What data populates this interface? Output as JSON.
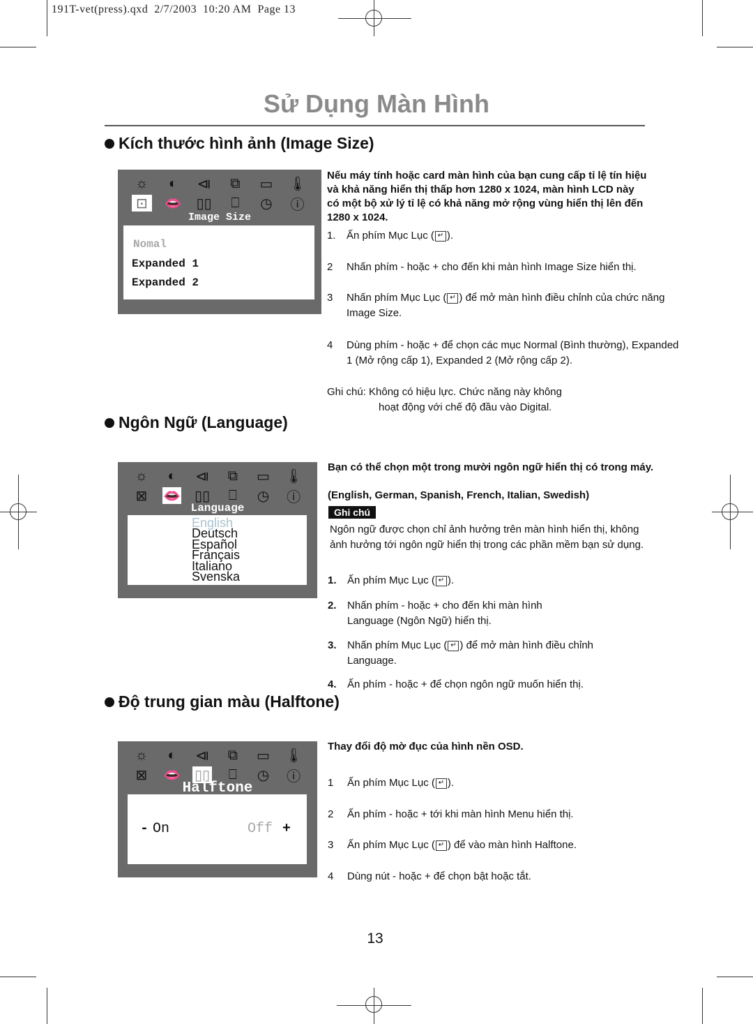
{
  "slug": "191T-vet(press).qxd  2/7/2003  10:20 AM  Page 13",
  "page_title": "Sử Dụng Màn Hình",
  "page_number": "13",
  "enter_key_glyph": "↵",
  "osd_icons": [
    "brightness-icon",
    "contrast-icon",
    "position-icon",
    "window-icon",
    "video-icon",
    "color-temperature-icon",
    "image-size-icon",
    "language-icon",
    "halftone-icon",
    "osd-position-icon",
    "timer-icon",
    "information-icon"
  ],
  "osd_icon_glyphs": [
    "☼",
    "◐",
    "◁",
    "⧉",
    "▭",
    "🌡",
    "⊠",
    "👄",
    "▯",
    "⎕",
    "◷",
    "ⓘ"
  ],
  "sections": {
    "image_size": {
      "heading": "Kích thước hình ảnh (Image Size)",
      "osd_title": "Image Size",
      "options": [
        {
          "label": "Nomal",
          "state": "inactive"
        },
        {
          "label": "Expanded 1",
          "state": "active"
        },
        {
          "label": "Expanded 2",
          "state": "active"
        }
      ],
      "intro": "Nếu máy tính hoặc card màn hình của bạn cung cấp tỉ lệ tín hiệu và khả năng hiển thị thấp hơn 1280 x 1024, màn hình LCD này có một bộ xử lý tỉ lệ có khả năng mở rộng vùng hiển thị lên đến 1280 x 1024.",
      "steps": [
        {
          "n": "1.",
          "pre": "Ấn phím Mục Lục (",
          "post": ")."
        },
        {
          "n": "2",
          "pre": "Nhấn phím - hoặc + cho đến khi màn hình Image Size hiển thị.",
          "post": ""
        },
        {
          "n": "3",
          "pre": "Nhấn phím Mục Lục (",
          "post": ") để mở màn hình điều chỉnh của chức năng Image Size."
        },
        {
          "n": "4",
          "pre": "Dùng phím - hoặc + để chọn các mục Normal (Bình thường), Expanded 1 (Mở rộng cấp 1), Expanded 2 (Mở rộng cấp 2).",
          "post": ""
        }
      ],
      "note_line1": "Ghi chú: Không có hiệu lực. Chức năng này không",
      "note_line2": "hoạt động với chế độ đầu vào Digital."
    },
    "language": {
      "heading": "Ngôn Ngữ (Language)",
      "osd_title": "Language",
      "options": [
        {
          "label": "English",
          "state": "selected"
        },
        {
          "label": "Deutsch",
          "state": "normal"
        },
        {
          "label": "Español",
          "state": "normal"
        },
        {
          "label": "Français",
          "state": "normal"
        },
        {
          "label": "Italiano",
          "state": "normal"
        },
        {
          "label": "Svenska",
          "state": "normal"
        }
      ],
      "intro": "Bạn có thể chọn một trong mười ngôn ngữ hiển thị có trong máy.",
      "languages_list": "(English, German, Spanish, French, Italian, Swedish)",
      "note_badge": "Ghi chú",
      "note": "Ngôn ngữ được chọn chỉ ảnh hưởng trên màn hình hiển thị, không ảnh hưởng tới ngôn ngữ hiển thị trong các phần mềm bạn sử dụng.",
      "steps": [
        {
          "n": "1.",
          "pre": "Ấn phím Mục Lục (",
          "post": ")."
        },
        {
          "n": "2.",
          "pre": "Nhấn phím - hoặc + cho đến khi màn hình Language (Ngôn Ngữ) hiển thị.",
          "post": ""
        },
        {
          "n": "3.",
          "pre": "Nhấn phím Mục Lục (",
          "post": ") để mở màn hình điều chỉnh Language."
        },
        {
          "n": "4.",
          "pre": "Ấn phím - hoặc + để chọn ngôn ngữ muốn hiển thị.",
          "post": ""
        }
      ]
    },
    "halftone": {
      "heading": "Độ trung gian màu (Halftone)",
      "osd_title": "Halftone",
      "minus": "-",
      "on_label": "On",
      "off_label": "Off",
      "plus": "+",
      "intro": "Thay đổi độ mờ đục của hình nền OSD.",
      "steps": [
        {
          "n": "1",
          "pre": "Ấn phím Mục Lục (",
          "post": ")."
        },
        {
          "n": "2",
          "pre": "Ấn phím - hoặc + tới khi màn hình Menu hiển thị.",
          "post": ""
        },
        {
          "n": "3",
          "pre": "Ấn phím Mục Lục (",
          "post": ") để vào màn hình Halftone."
        },
        {
          "n": "4",
          "pre": "Dùng nút - hoặc + để chọn bật hoặc tắt.",
          "post": ""
        }
      ]
    }
  },
  "colors": {
    "title_gray": "#8a8a8a",
    "osd_frame": "#6a6a6a",
    "inactive_option": "#a8a8a8",
    "selected_language": "#a9c3cf"
  }
}
